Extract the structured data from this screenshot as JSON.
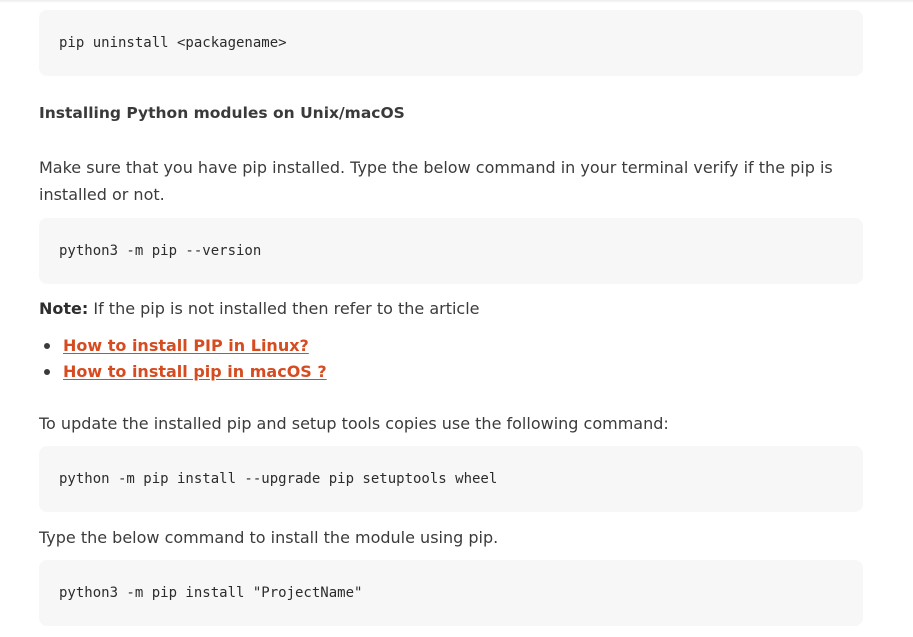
{
  "code_blocks": {
    "uninstall": "pip uninstall <packagename>",
    "version": "python3 -m pip --version",
    "upgrade": "python -m pip install --upgrade pip setuptools wheel",
    "install": "python3 -m pip install \"ProjectName\""
  },
  "heading": "Installing Python modules on Unix/macOS",
  "paragraphs": {
    "make_sure": "Make sure that you have pip installed. Type the below command in your terminal verify if the pip is installed or not.",
    "update": "To update the installed pip and setup tools copies use the following command:",
    "type_below": "Type the below command to install the module using pip."
  },
  "note": {
    "label": "Note:",
    "text": " If the pip is not installed then refer to the article"
  },
  "links": [
    {
      "label": "How to install PIP in Linux?"
    },
    {
      "label": "How to install pip in macOS ?"
    }
  ],
  "colors": {
    "link": "#d64b1f",
    "code_bg": "#f7f7f8",
    "text": "#3b3b3b"
  }
}
